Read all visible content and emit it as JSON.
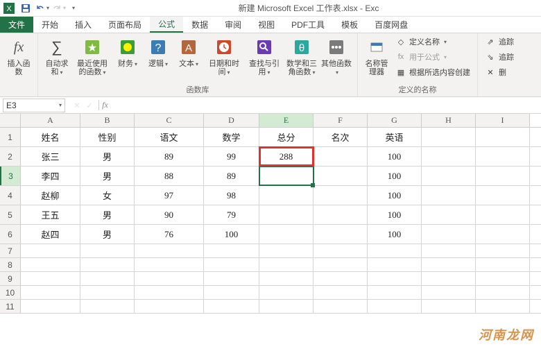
{
  "title": "新建 Microsoft Excel 工作表.xlsx - Exc",
  "qat": {
    "save": "💾",
    "undo": "↶",
    "redo": "↷"
  },
  "tabs": {
    "file": "文件",
    "items": [
      "开始",
      "插入",
      "页面布局",
      "公式",
      "数据",
      "审阅",
      "视图",
      "PDF工具",
      "模板",
      "百度网盘"
    ],
    "active": "公式"
  },
  "ribbon": {
    "group1_label": "",
    "insert_fn": "插入函数",
    "autosum": "自动求和",
    "recent": "最近使用的函数",
    "financial": "财务",
    "logical": "逻辑",
    "text": "文本",
    "datetime": "日期和时间",
    "lookup": "查找与引用",
    "math": "数学和三角函数",
    "other": "其他函数",
    "lib_label": "函数库",
    "name_mgr": "名称管理器",
    "define_name": "定义名称",
    "use_in_formula": "用于公式",
    "create_from_sel": "根据所选内容创建",
    "names_label": "定义的名称",
    "trace_prec": "追踪",
    "trace_dep": "追踪",
    "remove": "删"
  },
  "formula_bar": {
    "name_box": "E3",
    "fx": "fx",
    "value": ""
  },
  "columns": [
    "A",
    "B",
    "C",
    "D",
    "E",
    "F",
    "G",
    "H",
    "I"
  ],
  "active_col": "E",
  "active_row": 3,
  "rows": [
    {
      "n": 1,
      "A": "姓名",
      "B": "性别",
      "C": "语文",
      "D": "数学",
      "E": "总分",
      "F": "名次",
      "G": "英语"
    },
    {
      "n": 2,
      "A": "张三",
      "B": "男",
      "C": "89",
      "D": "99",
      "E": "288",
      "G": "100"
    },
    {
      "n": 3,
      "A": "李四",
      "B": "男",
      "C": "88",
      "D": "89",
      "G": "100"
    },
    {
      "n": 4,
      "A": "赵柳",
      "B": "女",
      "C": "97",
      "D": "98",
      "G": "100"
    },
    {
      "n": 5,
      "A": "王五",
      "B": "男",
      "C": "90",
      "D": "79",
      "G": "100"
    },
    {
      "n": 6,
      "A": "赵四",
      "B": "男",
      "C": "76",
      "D": "100",
      "G": "100"
    },
    {
      "n": 7
    },
    {
      "n": 8
    },
    {
      "n": 9
    },
    {
      "n": 10
    },
    {
      "n": 11
    }
  ],
  "highlight_cell": "E2",
  "selected_cell": "E3",
  "watermark": "河南龙网"
}
